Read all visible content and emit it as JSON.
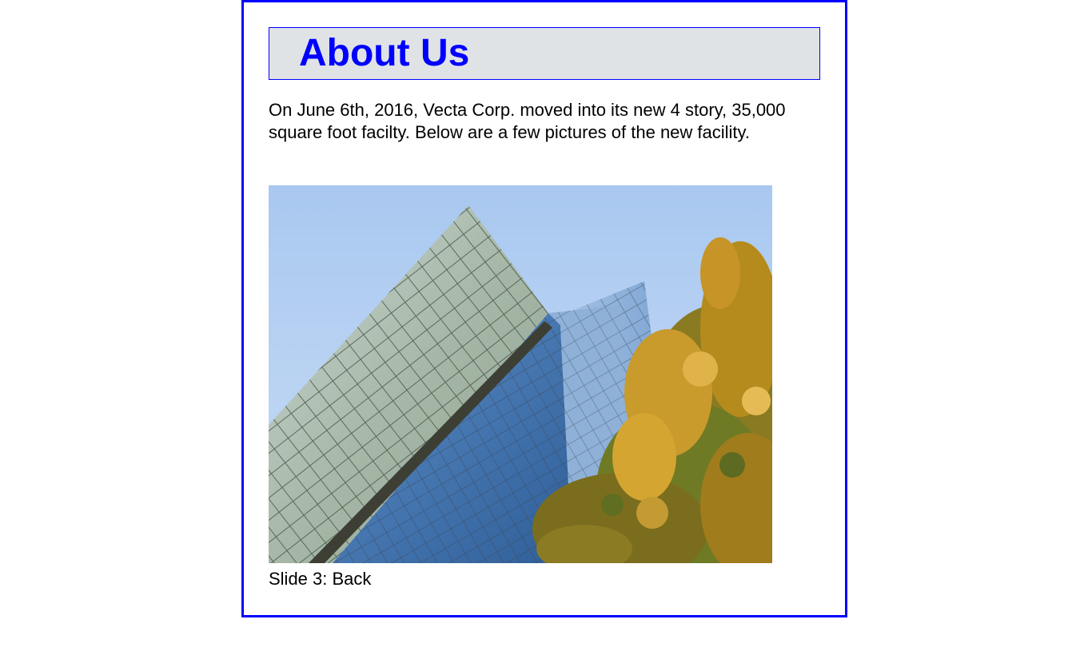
{
  "page": {
    "heading": "About Us",
    "intro": "On June 6th, 2016, Vecta Corp. moved into its new 4 story, 35,000 square foot facilty. Below are a few pictures of the new facility.",
    "slideshow": {
      "current_slide": 3,
      "caption": "Slide 3: Back",
      "image_subject": "building-photo"
    }
  },
  "colors": {
    "accent": "#0000ff",
    "header_bg": "#e0e3e6",
    "text": "#000000"
  }
}
